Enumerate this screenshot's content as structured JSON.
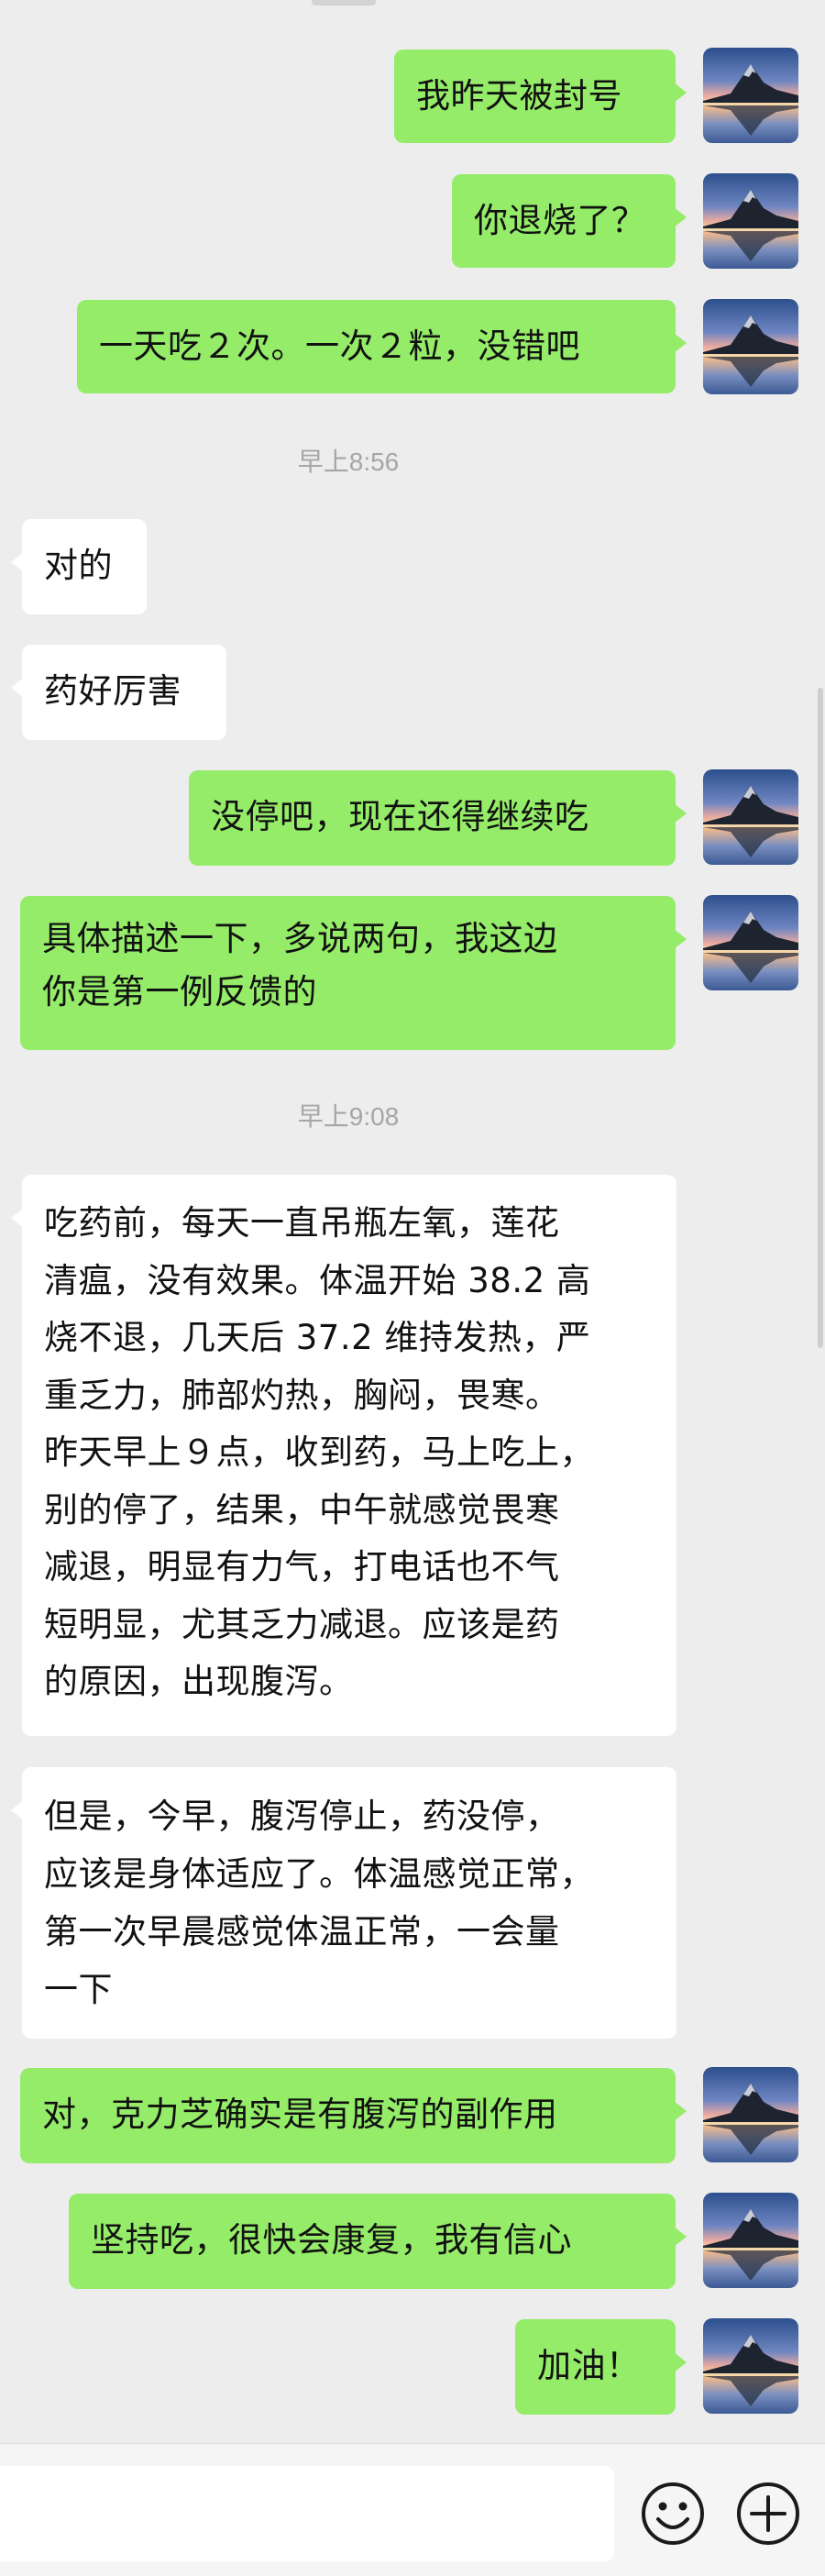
{
  "chat": {
    "messages": [
      {
        "dir": "out",
        "text": "我昨天被封号"
      },
      {
        "dir": "out",
        "text": "你退烧了？"
      },
      {
        "dir": "out",
        "text": "一天吃２次。一次２粒，没错吧"
      },
      {
        "type": "time",
        "text": "早上8:56"
      },
      {
        "dir": "in",
        "text": "对的"
      },
      {
        "dir": "in",
        "text": "药好厉害"
      },
      {
        "dir": "out",
        "text": "没停吧，现在还得继续吃"
      },
      {
        "dir": "out",
        "text": "具体描述一下，多说两句，我这边\n你是第一例反馈的"
      },
      {
        "type": "time",
        "text": "早上9:08"
      },
      {
        "dir": "in",
        "text": "吃药前，每天一直吊瓶左氧，莲花\n清瘟，没有效果。体温开始 38.2 高\n烧不退，几天后 37.2 维持发热，严\n重乏力，肺部灼热，胸闷，畏寒。\n昨天早上９点，收到药，马上吃上，\n别的停了，结果，中午就感觉畏寒\n减退，明显有力气，打电话也不气\n短明显，尤其乏力减退。应该是药\n的原因，出现腹泻。"
      },
      {
        "dir": "in",
        "text": "但是，今早，腹泻停止，药没停，\n应该是身体适应了。体温感觉正常，\n第一次早晨感觉体温正常，一会量\n一下"
      },
      {
        "dir": "out",
        "text": "对，克力芝确实是有腹泻的副作用"
      },
      {
        "dir": "out",
        "text": "坚持吃，很快会康复，我有信心"
      },
      {
        "dir": "out",
        "text": "加油！"
      }
    ]
  },
  "input_bar": {
    "emoji_icon": "emoji-icon",
    "add_icon": "plus-circle-icon"
  },
  "colors": {
    "background": "#ededed",
    "outgoing_bubble": "#95ec69",
    "incoming_bubble": "#ffffff",
    "timestamp": "#a6a6a6"
  }
}
